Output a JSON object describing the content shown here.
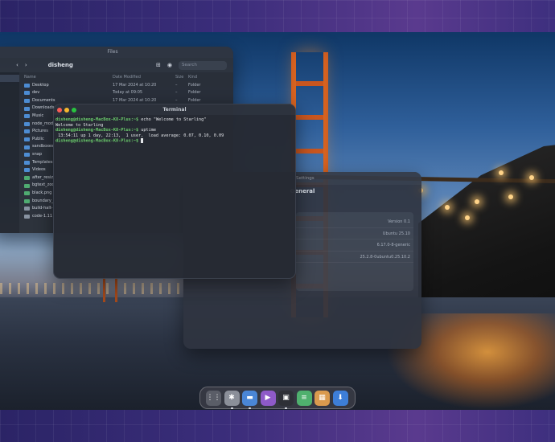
{
  "files": {
    "title": "Files",
    "breadcrumb": "disheng",
    "search_placeholder": "Search",
    "columns": [
      "Name",
      "Date Modified",
      "Size",
      "Kind"
    ],
    "rows": [
      {
        "name": "Desktop",
        "date": "17 Mar 2024 at 10:20",
        "size": "–",
        "kind": "Folder",
        "icon": "folder"
      },
      {
        "name": "dev",
        "date": "Today at 09:05",
        "size": "–",
        "kind": "Folder",
        "icon": "folder"
      },
      {
        "name": "Documents",
        "date": "17 Mar 2024 at 10:20",
        "size": "–",
        "kind": "Folder",
        "icon": "folder"
      },
      {
        "name": "Downloads",
        "date": "",
        "size": "",
        "kind": "",
        "icon": "folder"
      },
      {
        "name": "Music",
        "date": "",
        "size": "",
        "kind": "",
        "icon": "folder"
      },
      {
        "name": "node_mod",
        "date": "",
        "size": "",
        "kind": "",
        "icon": "folder"
      },
      {
        "name": "Pictures",
        "date": "",
        "size": "",
        "kind": "",
        "icon": "folder"
      },
      {
        "name": "Public",
        "date": "",
        "size": "",
        "kind": "",
        "icon": "folder"
      },
      {
        "name": "sandboxes",
        "date": "",
        "size": "",
        "kind": "",
        "icon": "folder"
      },
      {
        "name": "snap",
        "date": "",
        "size": "",
        "kind": "",
        "icon": "folder"
      },
      {
        "name": "Templates",
        "date": "",
        "size": "",
        "kind": "",
        "icon": "folder"
      },
      {
        "name": "Videos",
        "date": "",
        "size": "",
        "kind": "",
        "icon": "folder"
      },
      {
        "name": "after_resiz",
        "date": "",
        "size": "",
        "kind": "",
        "icon": "image"
      },
      {
        "name": "bgtext_zoo",
        "date": "",
        "size": "",
        "kind": "",
        "icon": "image"
      },
      {
        "name": "black.png",
        "date": "",
        "size": "",
        "kind": "",
        "icon": "image"
      },
      {
        "name": "boundary_",
        "date": "",
        "size": "",
        "kind": "",
        "icon": "image"
      },
      {
        "name": "build-halt-",
        "date": "",
        "size": "",
        "kind": "",
        "icon": "doc"
      },
      {
        "name": "code-1.11",
        "date": "",
        "size": "",
        "kind": "",
        "icon": "doc"
      }
    ]
  },
  "terminal": {
    "title": "Terminal",
    "lines": [
      {
        "prompt": "disheng@disheng-MacBox-K8-Plus:~$",
        "text": " echo \"Welcome to Starling\""
      },
      {
        "prompt": "",
        "text": "Welcome to Starling"
      },
      {
        "prompt": "disheng@disheng-MacBox-K8-Plus:~$",
        "text": " uptime"
      },
      {
        "prompt": "",
        "text": " 13:54:11 up 1 day, 22:13,  1 user,  load average: 0.07, 0.10, 0.09"
      },
      {
        "prompt": "disheng@disheng-MacBox-K8-Plus:~$",
        "text": " "
      }
    ]
  },
  "settings": {
    "title": "Settings",
    "heading": "General",
    "values": [
      "Version 0.1",
      "Ubuntu 25.10",
      "6.17.0-8-generic",
      "25.2.8-0ubuntu0.25.10.2"
    ]
  },
  "dock": {
    "items": [
      {
        "name": "app-grid",
        "glyph": "⋮⋮",
        "color": "#5a5d67",
        "running": false
      },
      {
        "name": "settings",
        "glyph": "✱",
        "color": "#8b8f99",
        "running": true
      },
      {
        "name": "files",
        "glyph": "▬",
        "color": "#4a86d6",
        "running": true
      },
      {
        "name": "media-player",
        "glyph": "▶",
        "color": "#8e5ac8",
        "running": false
      },
      {
        "name": "terminal",
        "glyph": "▣",
        "color": "#2e3037",
        "running": true
      },
      {
        "name": "text-editor",
        "glyph": "≡",
        "color": "#4fb06e",
        "running": false
      },
      {
        "name": "calculator",
        "glyph": "▦",
        "color": "#d99a4e",
        "running": false
      },
      {
        "name": "software-updater",
        "glyph": "⬇",
        "color": "#3d7ed8",
        "running": false
      }
    ]
  }
}
